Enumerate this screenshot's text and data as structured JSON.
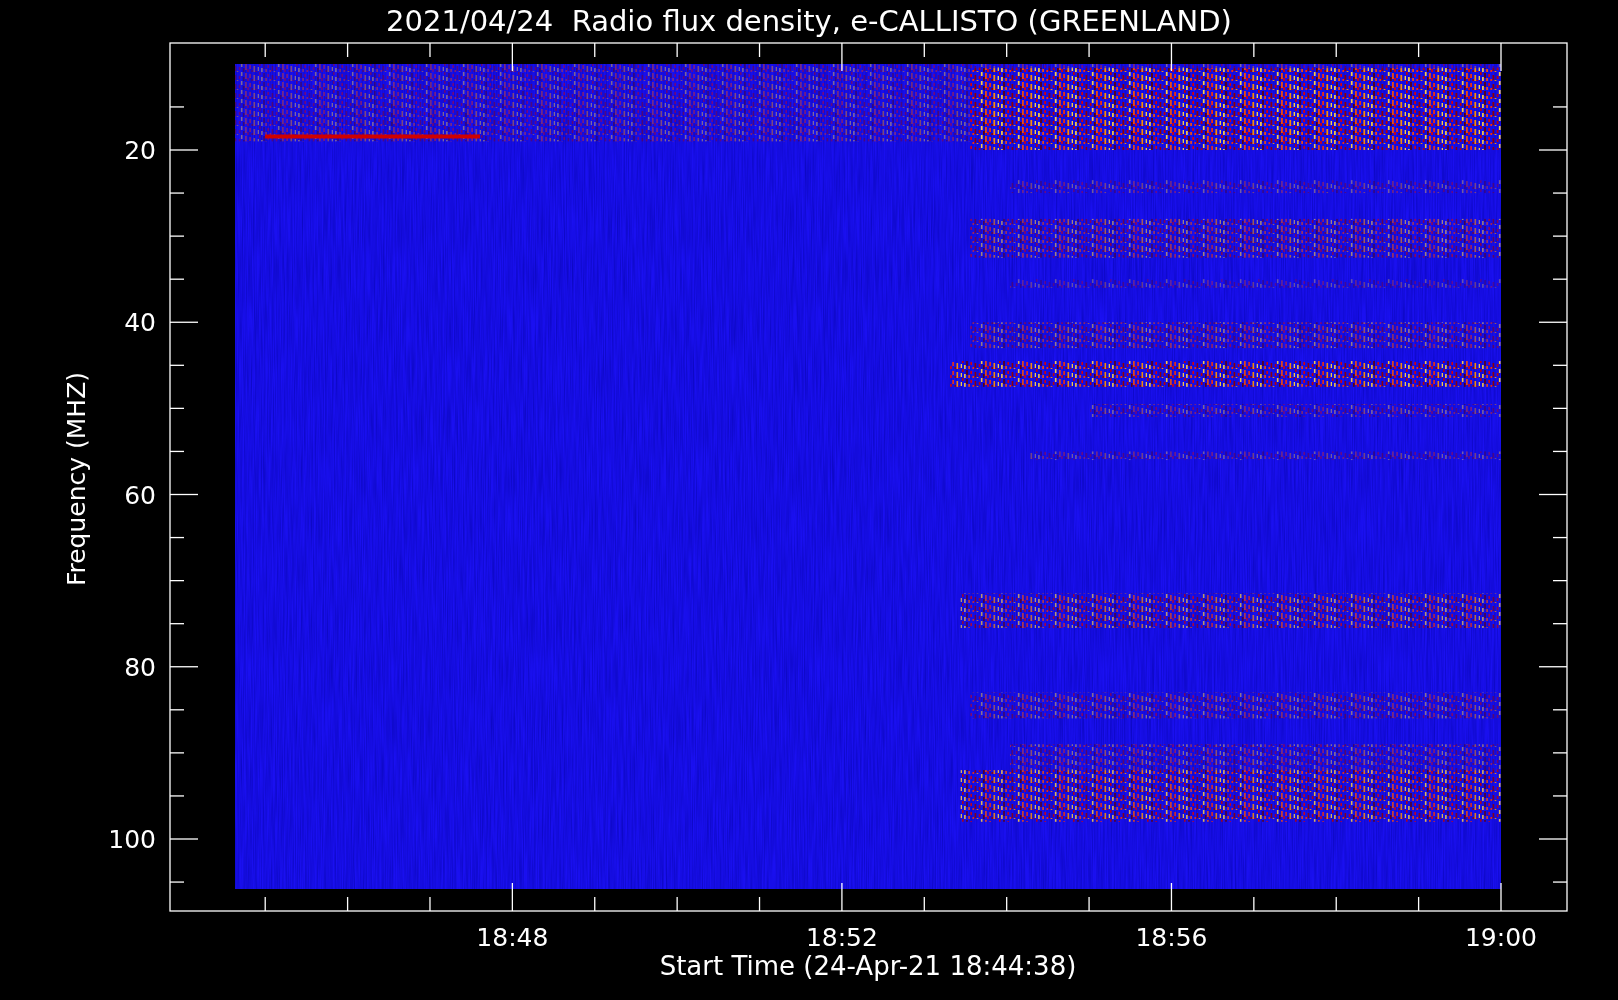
{
  "title": "2021/04/24  Radio flux density, e-CALLISTO (GREENLAND)",
  "plot": {
    "ylabel": "Frequency (MHZ)",
    "xlabel": "Start Time (24-Apr-21 18:44:38)",
    "yticks": [
      "20",
      "40",
      "60",
      "80",
      "100"
    ],
    "xticks": [
      "18:48",
      "18:52",
      "18:56",
      "19:00"
    ]
  }
}
